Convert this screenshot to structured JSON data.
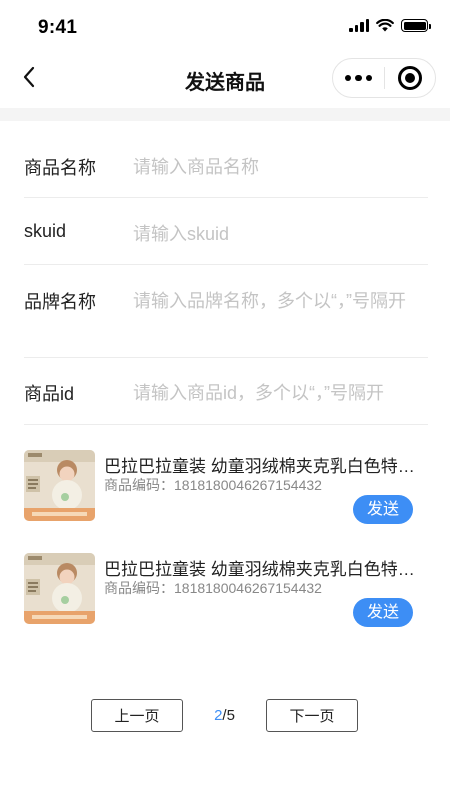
{
  "status_bar": {
    "time": "9:41"
  },
  "nav": {
    "title": "发送商品"
  },
  "form": {
    "fields": [
      {
        "label": "商品名称",
        "placeholder": "请输入商品名称",
        "value": ""
      },
      {
        "label": "skuid",
        "placeholder": "请输入skuid",
        "value": ""
      },
      {
        "label": "品牌名称",
        "placeholder": "请输入品牌名称，多个以“，”号隔开",
        "value": ""
      },
      {
        "label": "商品id",
        "placeholder": "请输入商品id，多个以“，”号隔开",
        "value": ""
      }
    ]
  },
  "products": [
    {
      "name": "巴拉巴拉童装 幼童羽绒棉夹克乳白色特价款",
      "code_label": "商品编码：",
      "code": "1818180046267154432",
      "send_label": "发送"
    },
    {
      "name": "巴拉巴拉童装 幼童羽绒棉夹克乳白色特价款",
      "code_label": "商品编码：",
      "code": "1818180046267154432",
      "send_label": "发送"
    }
  ],
  "pagination": {
    "prev_label": "上一页",
    "next_label": "下一页",
    "current": "2",
    "separator": "/",
    "total": "5"
  },
  "colors": {
    "accent": "#3d8ef5",
    "placeholder": "#c4c4c4",
    "divider": "#ececec"
  },
  "icons": {
    "back": "chevron-left-icon",
    "more": "more-dots-icon",
    "close": "target-icon",
    "thumb": "product-thumbnail-image"
  }
}
